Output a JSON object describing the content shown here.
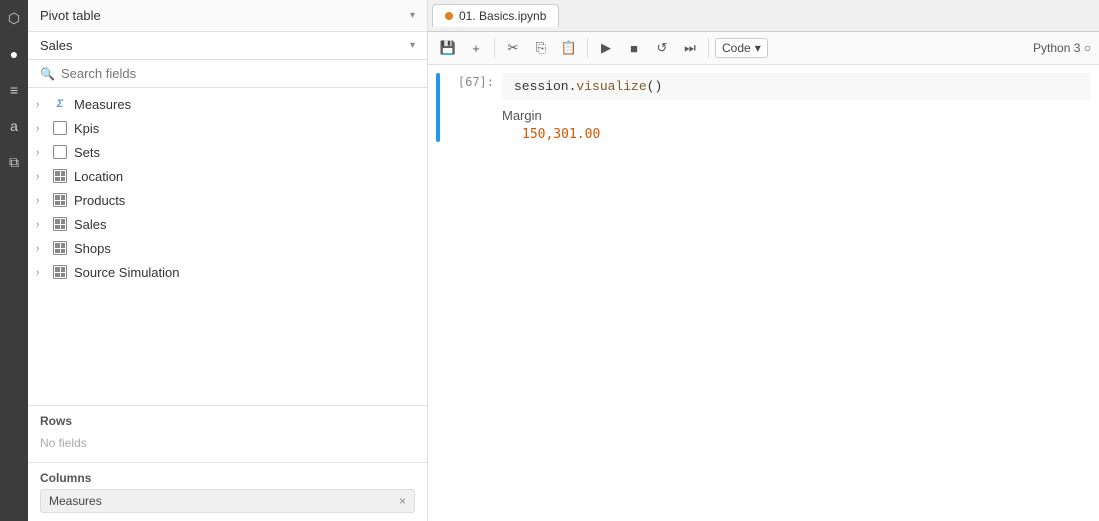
{
  "sidebar": {
    "icons": [
      {
        "name": "database-icon",
        "symbol": "⬡"
      },
      {
        "name": "circle-icon",
        "symbol": "●"
      },
      {
        "name": "list-icon",
        "symbol": "≡"
      },
      {
        "name": "a-icon",
        "symbol": "a"
      },
      {
        "name": "puzzle-icon",
        "symbol": "⧉"
      }
    ]
  },
  "pivot_panel": {
    "header": {
      "title": "Pivot table",
      "arrow": "▾"
    },
    "sales_label": "Sales",
    "sales_arrow": "▾",
    "search_placeholder": "Search fields",
    "fields": [
      {
        "name": "Measures",
        "icon_type": "sigma",
        "chevron": "›"
      },
      {
        "name": "Kpis",
        "icon_type": "kpi",
        "chevron": "›"
      },
      {
        "name": "Sets",
        "icon_type": "set",
        "chevron": "›"
      },
      {
        "name": "Location",
        "icon_type": "table",
        "chevron": "›"
      },
      {
        "name": "Products",
        "icon_type": "table",
        "chevron": "›"
      },
      {
        "name": "Sales",
        "icon_type": "table",
        "chevron": "›"
      },
      {
        "name": "Shops",
        "icon_type": "table",
        "chevron": "›"
      },
      {
        "name": "Source Simulation",
        "icon_type": "table",
        "chevron": "›"
      }
    ],
    "rows": {
      "label": "Rows",
      "no_fields": "No fields"
    },
    "columns": {
      "label": "Columns",
      "chip_label": "Measures",
      "chip_x": "×"
    }
  },
  "jupyter": {
    "tab": {
      "label": "01. Basics.ipynb"
    },
    "toolbar": {
      "save": "💾",
      "add": "+",
      "cut": "✂",
      "copy": "⎘",
      "paste": "📋",
      "run": "▶",
      "stop": "■",
      "restart": "↺",
      "fast_forward": "⏭",
      "code_label": "Code",
      "code_arrow": "▾",
      "kernel": "Python 3 ○"
    },
    "cell": {
      "prompt": "[67]:",
      "code": "session.visualize()",
      "output_label": "Margin",
      "output_value": "150,301.00"
    }
  }
}
